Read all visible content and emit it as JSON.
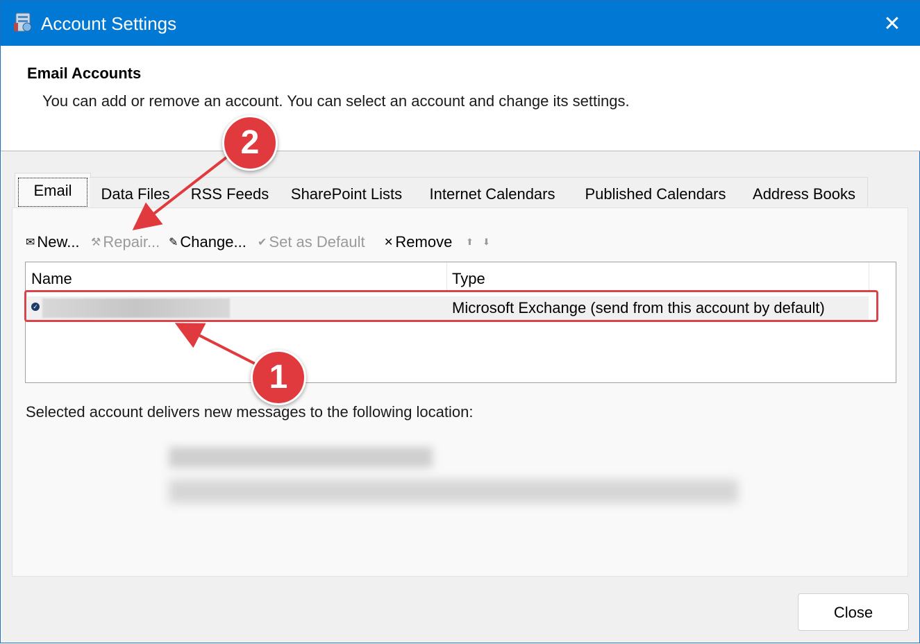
{
  "window": {
    "title": "Account Settings",
    "close_glyph": "✕"
  },
  "header": {
    "title": "Email Accounts",
    "subtitle": "You can add or remove an account. You can select an account and change its settings."
  },
  "tabs": [
    {
      "label": "Email",
      "active": true
    },
    {
      "label": "Data Files"
    },
    {
      "label": "RSS Feeds"
    },
    {
      "label": "SharePoint Lists"
    },
    {
      "label": "Internet Calendars"
    },
    {
      "label": "Published Calendars"
    },
    {
      "label": "Address Books"
    }
  ],
  "toolbar": {
    "new_label": "New...",
    "repair_label": "Repair...",
    "change_label": "Change...",
    "set_default_label": "Set as Default",
    "remove_label": "Remove",
    "up_glyph": "⬆",
    "down_glyph": "⬇"
  },
  "list": {
    "columns": [
      "Name",
      "Type"
    ],
    "rows": [
      {
        "name": "",
        "type": "Microsoft Exchange (send from this account by default)",
        "default": true
      }
    ]
  },
  "location": {
    "label": "Selected account delivers new messages to the following location:"
  },
  "annotations": {
    "badge_1": "1",
    "badge_2": "2",
    "color": "#e03a3e"
  },
  "footer": {
    "close_label": "Close"
  },
  "colors": {
    "titlebar": "#0078d4",
    "highlight": "#d9434a"
  }
}
